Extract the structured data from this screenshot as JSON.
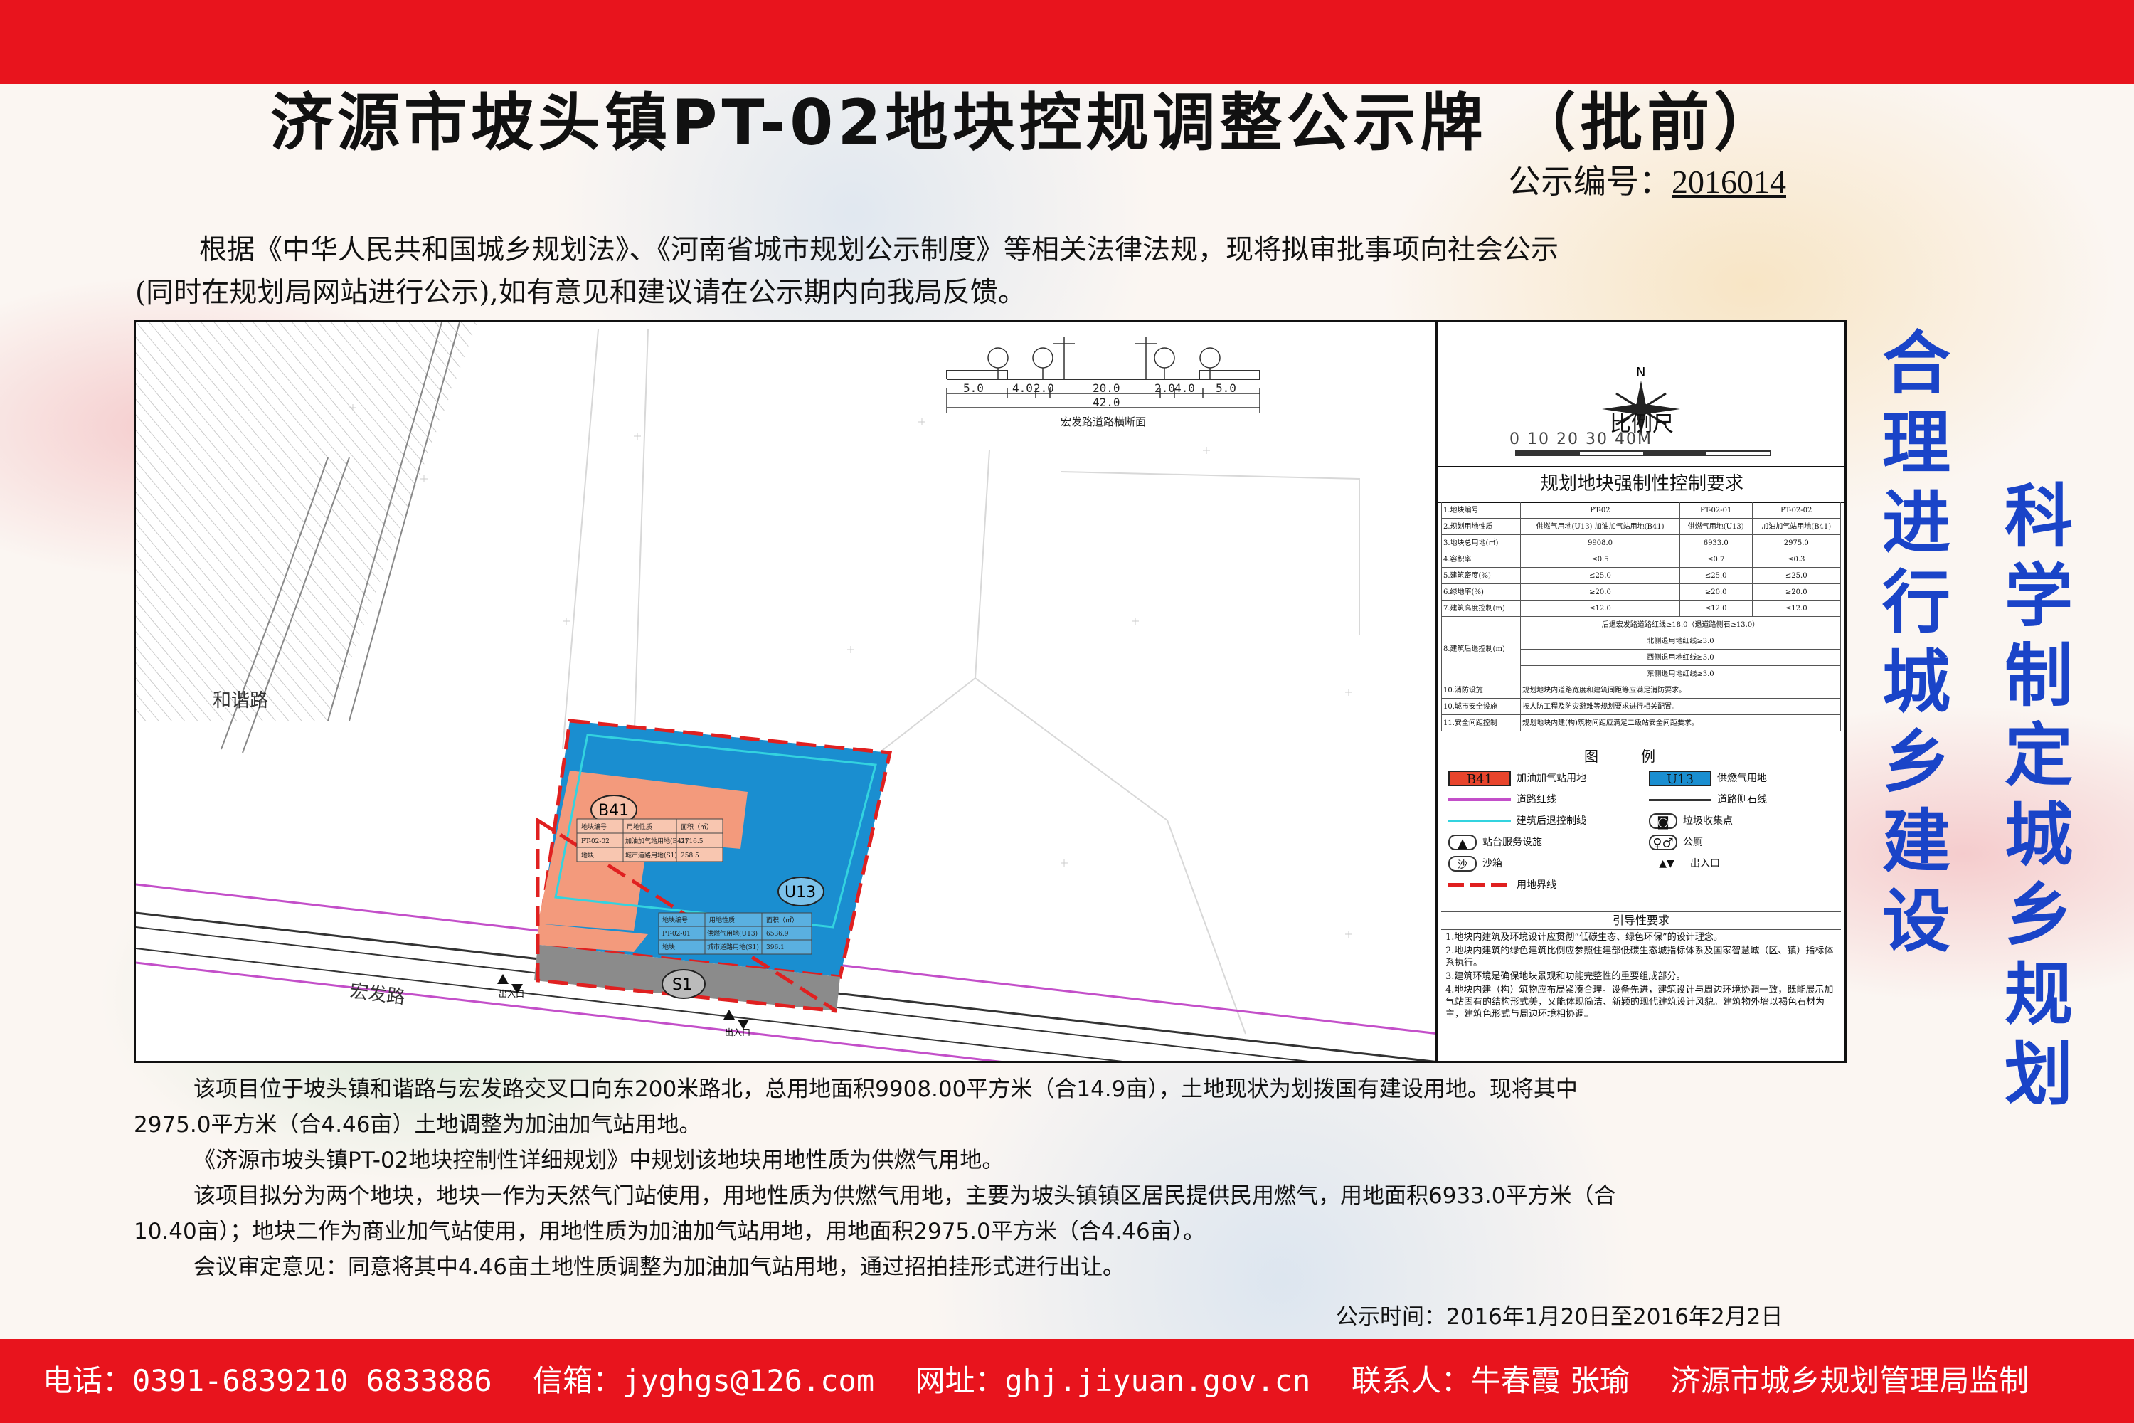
{
  "header": {
    "title": "济源市坡头镇PT-02地块控规调整公示牌 （批前）",
    "notice_label": "公示编号：",
    "notice_number": "2016014"
  },
  "intro": {
    "line1": "根据《中华人民共和国城乡规划法》、《河南省城市规划公示制度》等相关法律法规，现将拟审批事项向社会公示",
    "line2": "(同时在规划局网站进行公示),如有意见和建议请在公示期内向我局反馈。"
  },
  "map": {
    "section_dims": [
      "5.0",
      "4.0",
      "2.0",
      "20.0",
      "2.0",
      "4.0",
      "5.0"
    ],
    "section_total": "42.0",
    "section_caption": "宏发路道路横断面",
    "road_hexie": "和谐路",
    "road_hongfa": "宏发路",
    "label_b41": "B41",
    "label_u13": "U13",
    "label_s1": "S1",
    "entry_label": "出入口",
    "parcel1_table": {
      "headers": [
        "地块编号",
        "用地性质",
        "面积（㎡）"
      ],
      "rows": [
        [
          "PT-02-02",
          "加油加气站用地(B41)",
          "2716.5"
        ],
        [
          "地块",
          "城市道路用地(S1)",
          "258.5"
        ]
      ]
    },
    "parcel2_table": {
      "headers": [
        "地块编号",
        "用地性质",
        "面积（㎡）"
      ],
      "rows": [
        [
          "PT-02-01",
          "供燃气用地(U13)",
          "6536.9"
        ],
        [
          "地块",
          "城市道路用地(S1)",
          "396.1"
        ]
      ]
    }
  },
  "side": {
    "north": "N",
    "scale_title": "比例尺",
    "scale_nums": "0  10  20  30  40M",
    "control_title": "规划地块强制性控制要求",
    "control_table": [
      [
        "1.地块编号",
        "PT-02",
        "PT-02-01",
        "PT-02-02"
      ],
      [
        "2.规划用地性质",
        "供燃气用地(U13) 加油加气站用地(B41)",
        "供燃气用地(U13)",
        "加油加气站用地(B41)"
      ],
      [
        "3.地块总用地(㎡)",
        "9908.0",
        "6933.0",
        "2975.0"
      ],
      [
        "4.容积率",
        "≤0.5",
        "≤0.7",
        "≤0.3"
      ],
      [
        "5.建筑密度(%)",
        "≤25.0",
        "≤25.0",
        "≤25.0"
      ],
      [
        "6.绿地率(%)",
        "≥20.0",
        "≥20.0",
        "≥20.0"
      ],
      [
        "7.建筑高度控制(m)",
        "≤12.0",
        "≤12.0",
        "≤12.0"
      ]
    ],
    "setback_label": "8.建筑后退控制(m)",
    "setback_rows": [
      "后退宏发路道路红线≥18.0（退道路侧石≥13.0）",
      "北侧退用地红线≥3.0",
      "西侧退用地红线≥3.0",
      "东侧退用地红线≥3.0"
    ],
    "other_rows": [
      [
        "10.消防设施",
        "规划地块内道路宽度和建筑间距等应满足消防要求。"
      ],
      [
        "10.城市安全设施",
        "按人防工程及防灾避难等规划要求进行相关配置。"
      ],
      [
        "11.安全间距控制",
        "规划地块内建(构)筑物间距应满足二级站安全间距要求。"
      ]
    ],
    "legend_title": "图例",
    "legend": [
      {
        "code": "B41",
        "label": "加油加气站用地",
        "color": "#e8452c"
      },
      {
        "code": "U13",
        "label": "供燃气用地",
        "color": "#1a8ed0"
      },
      {
        "code": "",
        "label": "道路红线",
        "color": "#c34fc9"
      },
      {
        "code": "",
        "label": "道路侧石线",
        "color": "#333333"
      },
      {
        "code": "",
        "label": "建筑后退控制线",
        "color": "#33d3df"
      },
      {
        "code": "",
        "label": "垃圾收集点",
        "color": "#333333"
      },
      {
        "code": "",
        "label": "站台服务设施",
        "color": "#333333"
      },
      {
        "code": "",
        "label": "公厕",
        "color": "#333333"
      },
      {
        "code": "沙",
        "label": "沙箱",
        "color": "#333333"
      },
      {
        "code": "",
        "label": "出入口",
        "color": "#333333"
      },
      {
        "code": "",
        "label": "用地界线",
        "color": "#e02020"
      }
    ],
    "guide_title": "引导性要求",
    "guide": [
      "1.地块内建筑及环境设计应贯彻“低碳生态、绿色环保”的设计理念。",
      "2.地块内建筑的绿色建筑比例应参照住建部低碳生态城指标体系及国家智慧城（区、镇）指标体系执行。",
      "3.建筑环境是确保地块景观和功能完整性的重要组成部分。",
      "4.地块内建（构）筑物应布局紧凑合理。设备先进，建筑设计与周边环境协调一致，既能展示加气站固有的结构形式美，又能体现简洁、新颖的现代建筑设计风貌。建筑物外墙以褐色石材为主，建筑色形式与周边环境相协调。"
    ]
  },
  "slogans": {
    "left": "合理进行城乡建设",
    "right": "科学制定城乡规划"
  },
  "description": {
    "p1": "该项目位于坡头镇和谐路与宏发路交叉口向东200米路北，总用地面积9908.00平方米（合14.9亩），土地现状为划拨国有建设用地。现将其中",
    "p1b": "2975.0平方米（合4.46亩）土地调整为加油加气站用地。",
    "p2": "《济源市坡头镇PT-02地块控制性详细规划》中规划该地块用地性质为供燃气用地。",
    "p3": "该项目拟分为两个地块，地块一作为天然气门站使用，用地性质为供燃气用地，主要为坡头镇镇区居民提供民用燃气，用地面积6933.0平方米（合",
    "p3b": "10.40亩）；地块二作为商业加气站使用，用地性质为加油加气站用地，用地面积2975.0平方米（合4.46亩）。",
    "p4": "会议审定意见：同意将其中4.46亩土地性质调整为加油加气站用地，通过招拍挂形式进行出让。",
    "period": "公示时间：2016年1月20日至2016年2月2日"
  },
  "footer": {
    "phone": "电话：0391-6839210 6833886",
    "email": "信箱：jyghgs@126.com",
    "site": "网址：ghj.jiyuan.gov.cn",
    "contact": "联系人：牛春霞 张瑜",
    "org": "济源市城乡规划管理局监制"
  }
}
